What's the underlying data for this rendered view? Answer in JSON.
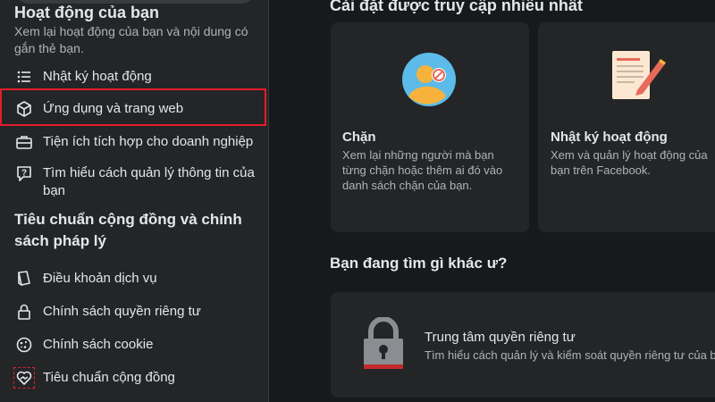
{
  "sidebar": {
    "activity_title": "Hoạt động của bạn",
    "activity_desc": "Xem lại hoạt động của bạn và nội dung có gắn thẻ bạn.",
    "items": [
      {
        "label": "Nhật ký hoạt động",
        "icon": "list-icon"
      },
      {
        "label": "Ứng dụng và trang web",
        "icon": "cube-icon"
      },
      {
        "label": "Tiện ích tích hợp cho doanh nghiệp",
        "icon": "briefcase-icon"
      },
      {
        "label": "Tìm hiểu cách quản lý thông tin của bạn",
        "icon": "question-bubble-icon"
      }
    ],
    "policy_title": "Tiêu chuẩn cộng đồng và chính sách pháp lý",
    "policy_items": [
      {
        "label": "Điều khoản dịch vụ",
        "icon": "book-icon"
      },
      {
        "label": "Chính sách quyền riêng tư",
        "icon": "lock-icon"
      },
      {
        "label": "Chính sách cookie",
        "icon": "cookie-icon"
      },
      {
        "label": "Tiêu chuẩn cộng đồng",
        "icon": "heart-hands-icon"
      }
    ]
  },
  "main": {
    "most_visited_title": "Cài đặt được truy cập nhiều nhất",
    "cards": [
      {
        "title": "Chặn",
        "desc": "Xem lại những người mà bạn từng chặn hoặc thêm ai đó vào danh sách chặn của bạn.",
        "icon": "blocked-user-icon"
      },
      {
        "title": "Nhật ký hoạt động",
        "desc": "Xem và quản lý hoạt động của bạn trên Facebook.",
        "icon": "document-pen-icon"
      }
    ],
    "other_title": "Bạn đang tìm gì khác ư?",
    "privacy_center": {
      "title": "Trung tâm quyền riêng tư",
      "desc": "Tìm hiểu cách quản lý và kiểm soát quyền riêng tư của bạn",
      "icon": "padlock-icon"
    }
  },
  "colors": {
    "highlight": "#e41e2b",
    "sidebar_bg": "#242526",
    "page_bg": "#18191a",
    "card_bg": "#242526"
  }
}
